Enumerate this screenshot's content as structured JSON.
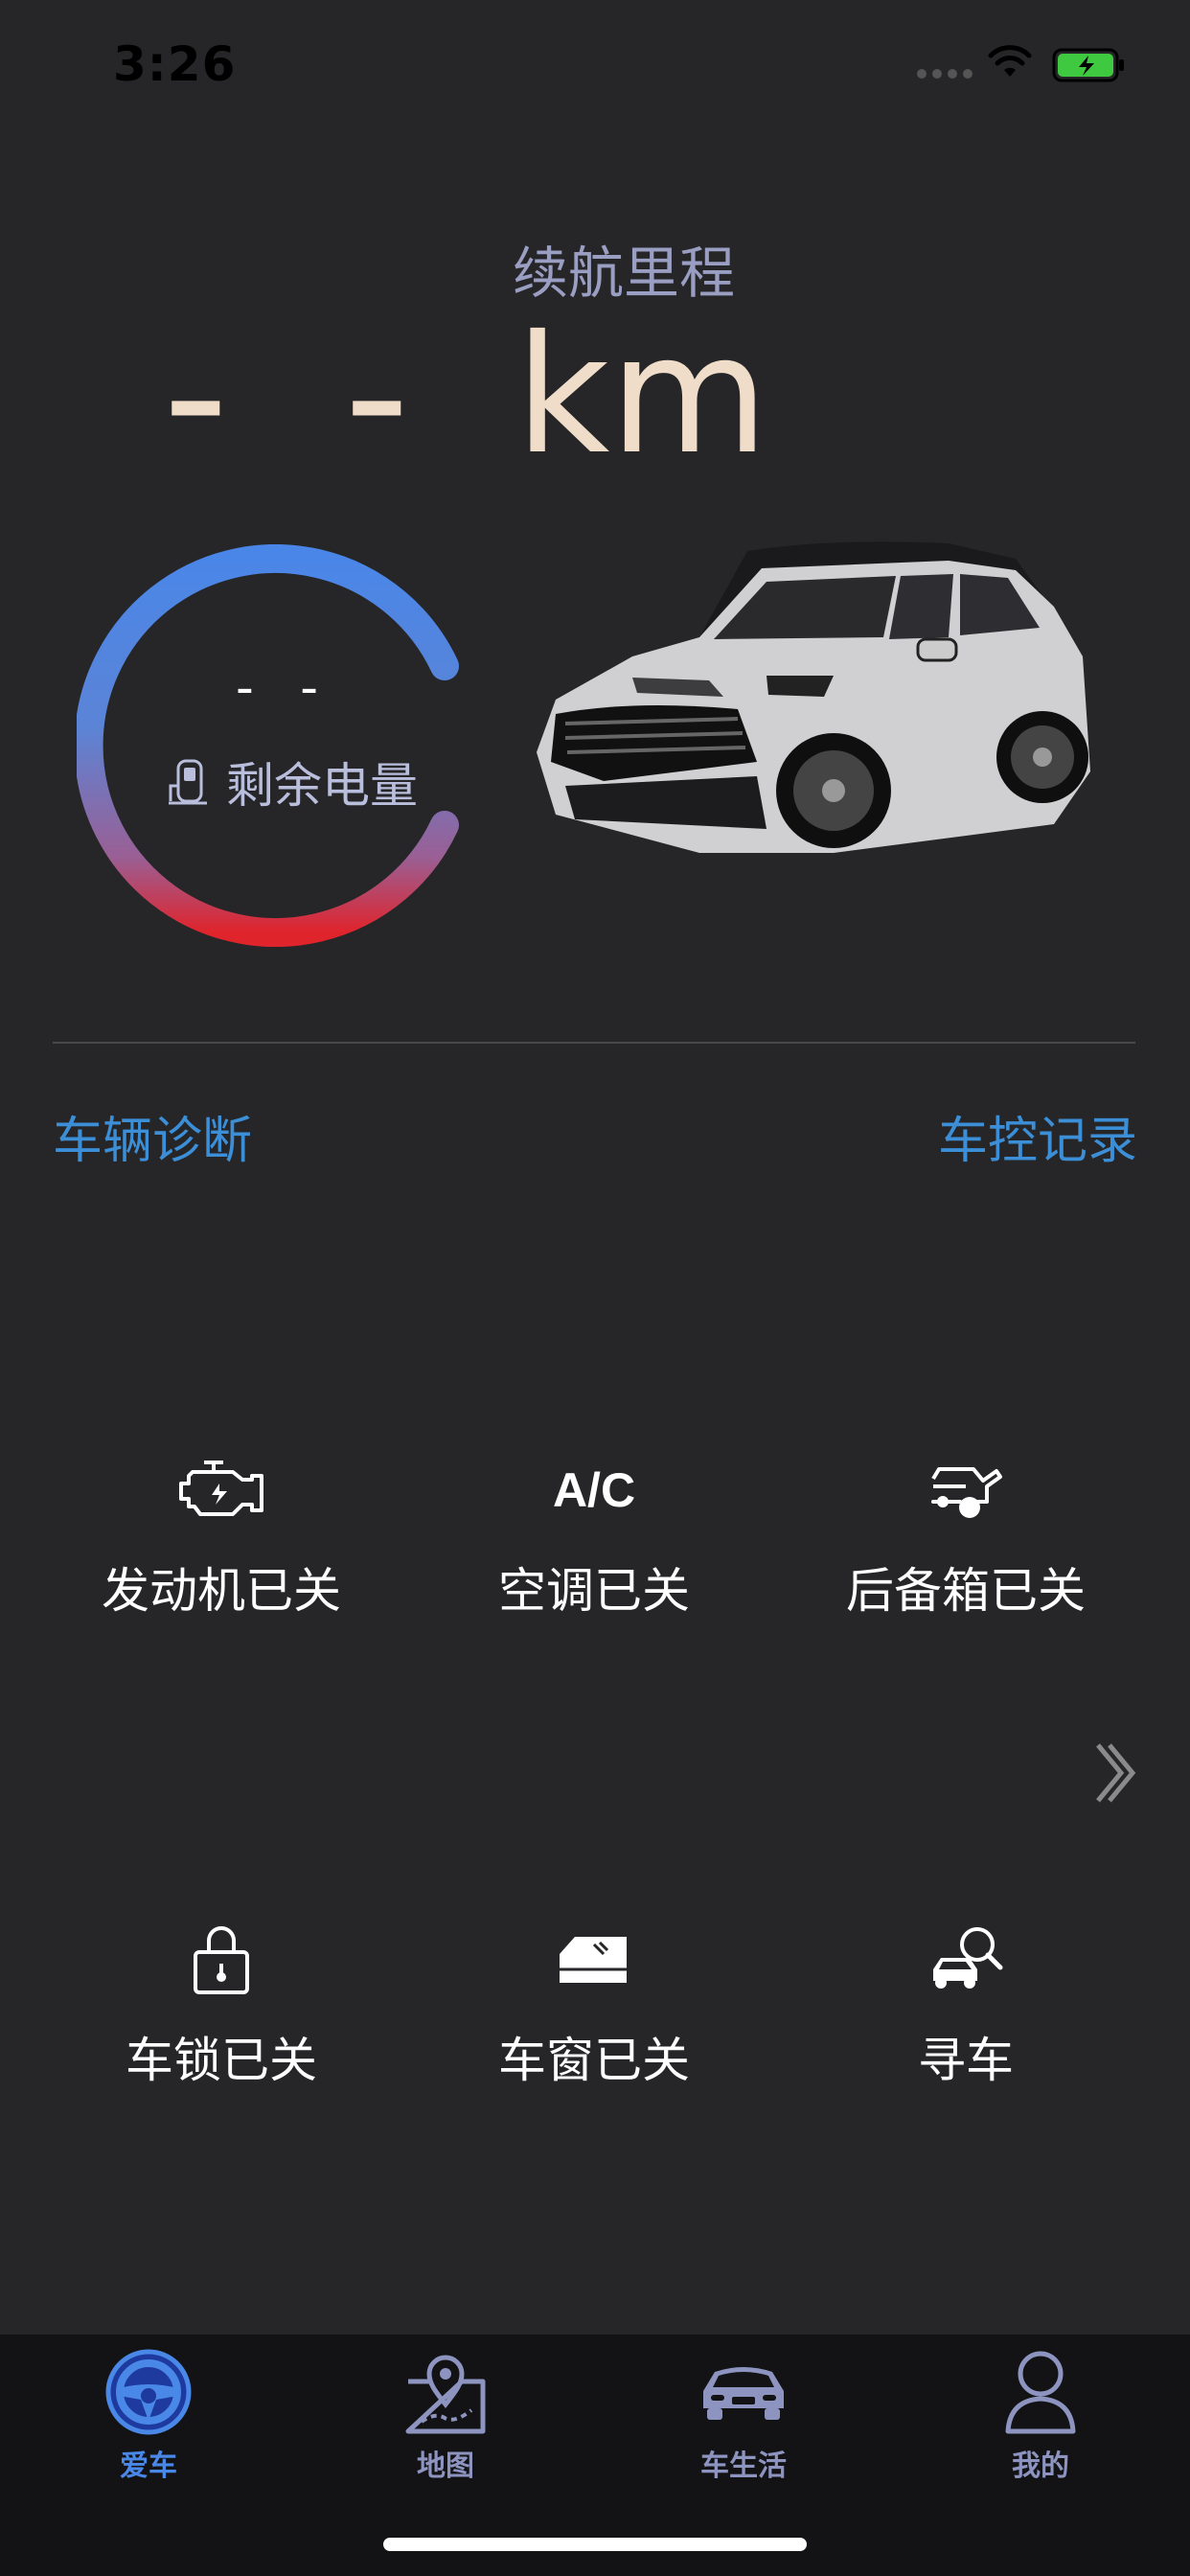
{
  "status_bar": {
    "time": "3:26"
  },
  "range": {
    "label": "续航里程",
    "value": "- -",
    "unit": "km"
  },
  "gauge": {
    "value": "- -",
    "label": "剩余电量",
    "icon": "charging-pile-icon"
  },
  "links": {
    "diagnosis": "车辆诊断",
    "control_log": "车控记录"
  },
  "controls": [
    {
      "label": "发动机已关",
      "icon": "engine-icon"
    },
    {
      "label": "空调已关",
      "icon": "ac-icon",
      "icon_text": "A/C"
    },
    {
      "label": "后备箱已关",
      "icon": "trunk-icon"
    },
    {
      "label": "车锁已关",
      "icon": "lock-icon"
    },
    {
      "label": "车窗已关",
      "icon": "window-icon"
    },
    {
      "label": "寻车",
      "icon": "find-car-icon"
    }
  ],
  "tabs": [
    {
      "label": "爱车",
      "icon": "steering-wheel-icon",
      "active": true
    },
    {
      "label": "地图",
      "icon": "map-pin-icon",
      "active": false
    },
    {
      "label": "车生活",
      "icon": "car-front-icon",
      "active": false
    },
    {
      "label": "我的",
      "icon": "person-icon",
      "active": false
    }
  ],
  "colors": {
    "background": "#262628",
    "accent_blue": "#3c8fd7",
    "range_text": "#efdcc9",
    "gauge_start": "#4a86e8",
    "gauge_end": "#e0242c",
    "tab_inactive": "#8d94c0"
  }
}
